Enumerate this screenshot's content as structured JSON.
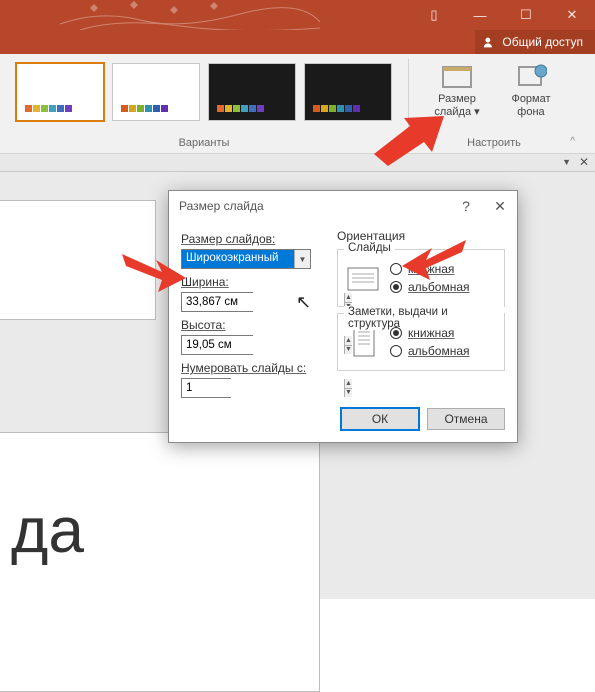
{
  "titlebar": {
    "share_label": "Общий доступ"
  },
  "ribbon": {
    "variants_label": "Варианты",
    "customize_label": "Настроить",
    "slide_size_label": "Размер\nслайда",
    "slide_size_caret": "▾",
    "format_bg_label": "Формат\nфона",
    "thumb_colors_light": [
      "#e26a2c",
      "#e2b32c",
      "#8fbf3f",
      "#3fa0bf",
      "#3f6ebf",
      "#6e3fbf"
    ],
    "thumb_colors_dark": [
      "#d65c1e",
      "#d6a61e",
      "#7eb02f",
      "#2f91b0",
      "#2f5fb0",
      "#5f2fb0"
    ]
  },
  "dialog": {
    "title": "Размер слайда",
    "fields": {
      "size_for_label": "Размер слайдов:",
      "size_value": "Широкоэкранный",
      "width_label": "Ширина:",
      "width_value": "33,867 см",
      "height_label": "Высота:",
      "height_value": "19,05 см",
      "number_from_label": "Нумеровать слайды с:",
      "number_from_value": "1"
    },
    "orientation": {
      "heading": "Ориентация",
      "slides_label": "Слайды",
      "notes_label": "Заметки, выдачи и структура",
      "portrait": "книжная",
      "landscape": "альбомная",
      "slides_selected": "landscape",
      "notes_selected": "portrait"
    },
    "buttons": {
      "ok": "ОК",
      "cancel": "Отмена"
    }
  },
  "canvas": {
    "slide_text_fragment": "да"
  }
}
